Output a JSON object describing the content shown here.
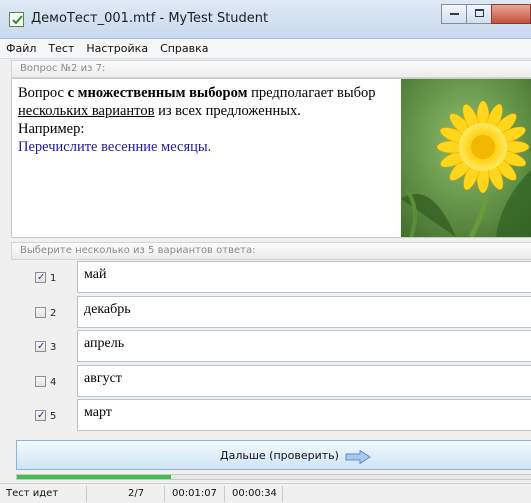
{
  "window": {
    "title": "ДемоТест_001.mtf - MyTest Student",
    "app_icon": "checkbox-app-icon"
  },
  "menu": [
    "Файл",
    "Тест",
    "Настройка",
    "Справка"
  ],
  "question": {
    "header": "Вопрос №2 из 7:",
    "text_part1": "Вопрос ",
    "text_bold": "с множественным выбором",
    "text_part2": " предполагает выбор ",
    "text_underline": "нескольких вариантов",
    "text_part3": " из всех предложенных.",
    "text_line3": "Например:",
    "text_example": "Перечислите весенние месяцы.",
    "image": "dandelion-flower-photo"
  },
  "answers": {
    "header": "Выберите несколько из 5 вариантов ответа:",
    "items": [
      {
        "num": "1",
        "text": "май",
        "checked": true
      },
      {
        "num": "2",
        "text": "декабрь",
        "checked": false
      },
      {
        "num": "3",
        "text": "апрель",
        "checked": true
      },
      {
        "num": "4",
        "text": "август",
        "checked": false
      },
      {
        "num": "5",
        "text": "март",
        "checked": true
      }
    ]
  },
  "next_button": {
    "label": "Дальше (проверить)",
    "icon": "arrow-right-icon"
  },
  "progress": {
    "fraction": 0.3
  },
  "status": {
    "state": "Тест идет",
    "counter": "2/7",
    "elapsed": "00:01:07",
    "question_time": "00:00:34"
  },
  "colors": {
    "accent_blue": "#1a1aa8",
    "progress_green": "#3cc24a"
  }
}
